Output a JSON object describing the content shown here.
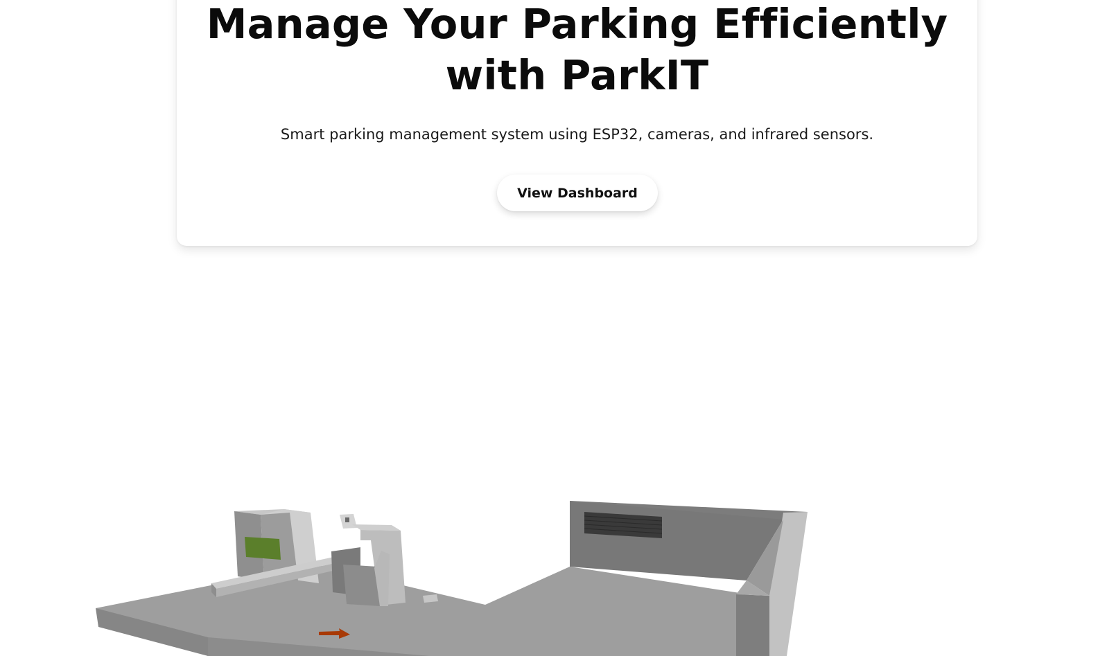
{
  "hero": {
    "title_line1": "Manage Your Parking Efficiently",
    "title_line2": "with ParkIT",
    "subtitle": "Smart parking management system using ESP32, cameras, and infrared sensors.",
    "cta_label": "View Dashboard"
  },
  "colors": {
    "background": "#ffffff",
    "text": "#0b0b0b",
    "floor": "#9e9e9e",
    "wall": "#7a7a7a",
    "display_screen": "#5b7f2b",
    "direction_arrow": "#a83a06",
    "vent_grille": "#3a3a3a"
  },
  "scene": {
    "description_icons": [
      "parking-lot-model",
      "gate-barrier",
      "ticket-kiosk",
      "camera-post",
      "direction-arrow",
      "vent-grille"
    ]
  }
}
